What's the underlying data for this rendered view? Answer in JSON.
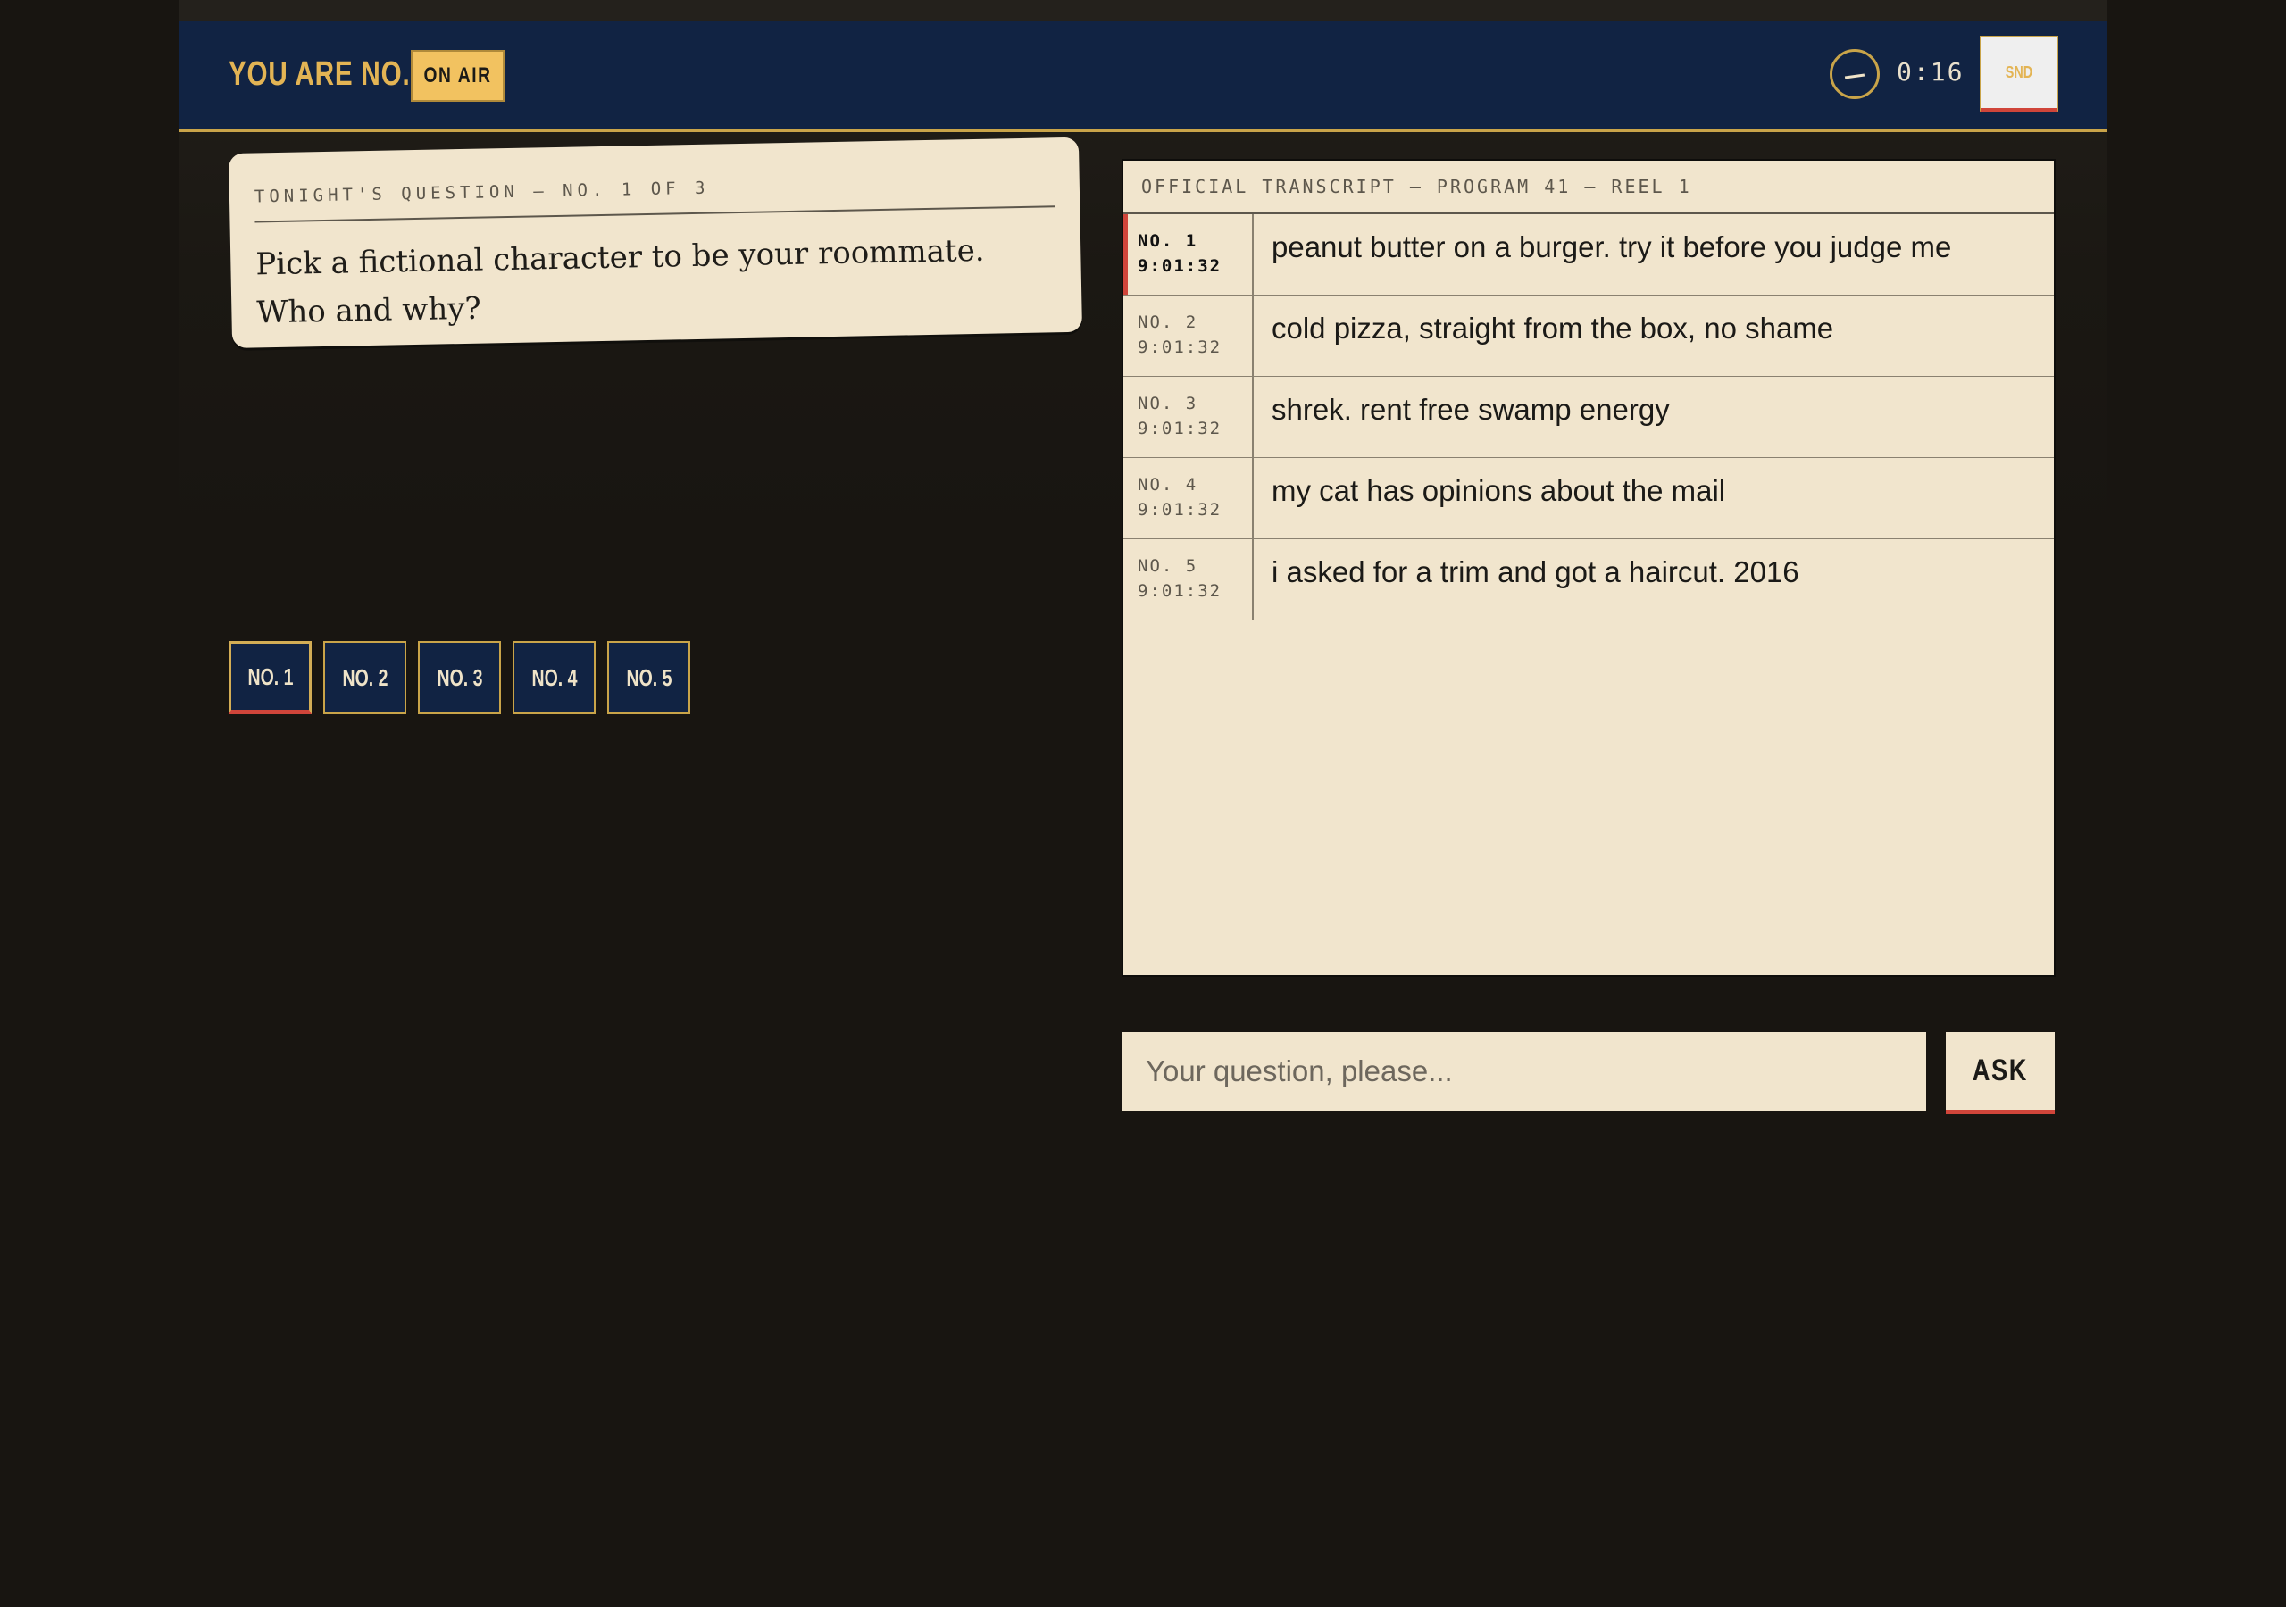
{
  "header": {
    "player_label": "YOU ARE NO. 1",
    "status_badge": "ON AIR",
    "timer": "0:16",
    "sound_button": "SND"
  },
  "question": {
    "label": "TONIGHT'S QUESTION — NO. 1 OF 3",
    "text": "Pick a fictional character to be your roommate. Who and why?"
  },
  "players": [
    {
      "label": "NO. 1",
      "active": true
    },
    {
      "label": "NO. 2",
      "active": false
    },
    {
      "label": "NO. 3",
      "active": false
    },
    {
      "label": "NO. 4",
      "active": false
    },
    {
      "label": "NO. 5",
      "active": false
    }
  ],
  "transcript": {
    "title": "OFFICIAL TRANSCRIPT — PROGRAM 41 — REEL 1",
    "rows": [
      {
        "player": "NO. 1",
        "time": "9:01:32",
        "message": "peanut butter on a burger. try it before you judge me",
        "active": true
      },
      {
        "player": "NO. 2",
        "time": "9:01:32",
        "message": "cold pizza, straight from the box, no shame",
        "active": false
      },
      {
        "player": "NO. 3",
        "time": "9:01:32",
        "message": "shrek. rent free swamp energy",
        "active": false
      },
      {
        "player": "NO. 4",
        "time": "9:01:32",
        "message": "my cat has opinions about the mail",
        "active": false
      },
      {
        "player": "NO. 5",
        "time": "9:01:32",
        "message": "i asked for a trim and got a haircut. 2016",
        "active": false
      }
    ]
  },
  "ask": {
    "placeholder": "Your question, please...",
    "value": "",
    "button_label": "ASK"
  },
  "colors": {
    "navy": "#112343",
    "gold": "#c9a449",
    "cream": "#f1e5cd",
    "red_accent": "#d0453a",
    "background": "#181511"
  }
}
